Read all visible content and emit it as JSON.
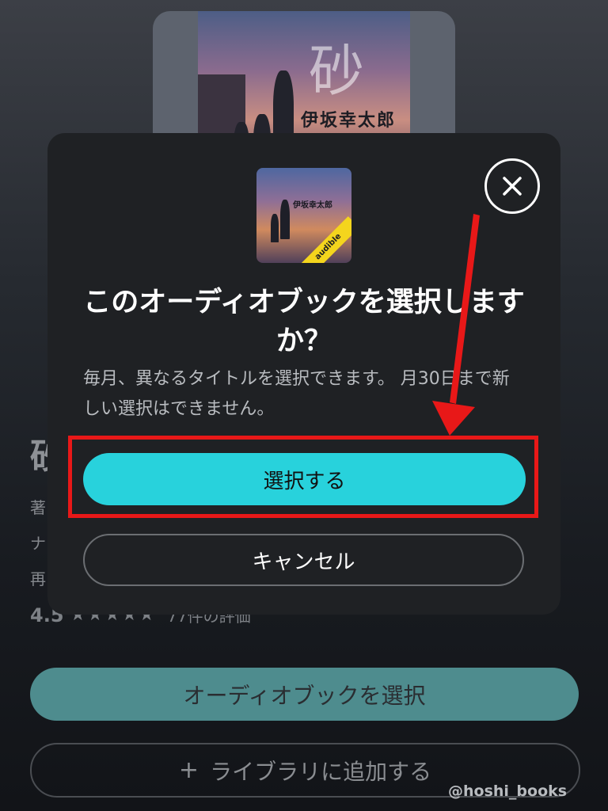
{
  "background": {
    "cover_author": "伊坂幸太郎",
    "cover_title_glyph": "砂",
    "title_partial": "砂",
    "meta_rows": [
      "著",
      "ナ",
      "再"
    ],
    "rating": {
      "score": "4.5",
      "stars": "★★★★★",
      "count_text": "77件の評価"
    },
    "primary_button": "オーディオブックを選択",
    "secondary_button": "ライブラリに追加する",
    "secondary_button_icon": "plus-icon"
  },
  "modal": {
    "thumbnail": {
      "author": "伊坂幸太郎",
      "badge": "audible"
    },
    "close_icon": "close-icon",
    "title": "このオーディオブックを選択しますか？",
    "description": "毎月、異なるタイトルを選択できます。 月30日まで新しい選択はできません。",
    "select_button": "選択する",
    "cancel_button": "キャンセル"
  },
  "annotation": {
    "color": "#e81818"
  },
  "colors": {
    "accent": "#28d2dc",
    "modal_bg": "#1f2124"
  },
  "watermark": "@hoshi_books"
}
